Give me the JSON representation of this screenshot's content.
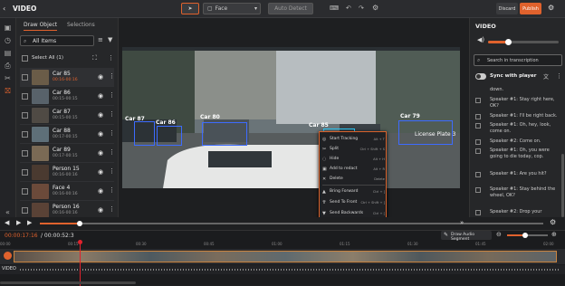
{
  "app": {
    "title": "VIDEO"
  },
  "toolbar": {
    "tool_selected": "Face",
    "auto_detect": "Auto Detect",
    "discard": "Discard",
    "publish": "Publish"
  },
  "left": {
    "tab1": "Draw Object",
    "tab2": "Selections",
    "search_placeholder": "All Items",
    "select_all": "Select All (1)",
    "objects": [
      {
        "name": "Car 85",
        "time": "00:16-00:16",
        "active": true
      },
      {
        "name": "Car 86",
        "time": "00:15-00:15",
        "active": false
      },
      {
        "name": "Car 87",
        "time": "00:15-00:15",
        "active": false
      },
      {
        "name": "Car 88",
        "time": "00:17-00:15",
        "active": false
      },
      {
        "name": "Car 89",
        "time": "00:17-00:15",
        "active": false
      },
      {
        "name": "Person 15",
        "time": "00:16-00:16",
        "active": false
      },
      {
        "name": "Face 4",
        "time": "00:16-00:16",
        "active": false
      },
      {
        "name": "Person 16",
        "time": "00:16-00:16",
        "active": false
      }
    ]
  },
  "video": {
    "labels": {
      "car87": "Car 87",
      "car86": "Car 86",
      "car80": "Car 80",
      "car85": "Car 85",
      "car79": "Car 79",
      "plate": "License Plate 3"
    }
  },
  "context_menu": {
    "items": [
      {
        "label": "Start Tracking",
        "shortcut": "Alt + T",
        "icon": "track-icon"
      },
      {
        "label": "Split",
        "shortcut": "Ctrl + Shift + S",
        "icon": "split-icon"
      },
      {
        "label": "Hide",
        "shortcut": "Alt + H",
        "icon": "hide-icon"
      },
      {
        "label": "Add to redact",
        "shortcut": "Alt + R",
        "icon": "redact-icon"
      },
      {
        "label": "Delete",
        "shortcut": "Delete",
        "icon": "delete-icon"
      },
      {
        "label": "Bring Forward",
        "shortcut": "Ctrl + ]",
        "icon": "bring-forward-icon"
      },
      {
        "label": "Send To Front",
        "shortcut": "Ctrl + Shift + ]",
        "icon": "send-front-icon"
      },
      {
        "label": "Send Backwards",
        "shortcut": "Ctrl + [",
        "icon": "send-backwards-icon"
      },
      {
        "label": "Send To Back",
        "shortcut": "Ctrl + Shift + [",
        "icon": "send-back-icon"
      }
    ]
  },
  "right": {
    "title": "VIDEO",
    "search_placeholder": "Search in transcription",
    "sync_label": "Sync with player",
    "transcript": [
      {
        "text": "down.",
        "checkbox": false
      },
      {
        "text": "Speaker #1: Stay right here, OK?",
        "checkbox": true
      },
      {
        "text": "Speaker #1: I'll be right back.",
        "checkbox": true
      },
      {
        "text": "Speaker #1: Oh, hey, look, come on.",
        "checkbox": true
      },
      {
        "text": "Speaker #2: Come on.",
        "checkbox": true
      },
      {
        "text": "Speaker #1: Oh, you were going to die today, cop.",
        "checkbox": true
      },
      {
        "text": "Speaker #1: Are you hit?",
        "checkbox": true
      },
      {
        "text": "Speaker #1: Stay behind the wheel, OK?",
        "checkbox": true
      },
      {
        "text": "Speaker #2: Drop your",
        "checkbox": true
      }
    ]
  },
  "player": {
    "current_time": "00:00:17:16",
    "total_time": "/ 00:00:52:3",
    "draw_audio": "Draw Audio Segment",
    "track_label": "VIDEO",
    "ticks": [
      "00:00",
      "00:15",
      "00:30",
      "00:45",
      "01:00",
      "01:15",
      "01:30",
      "01:45",
      "02:00"
    ]
  }
}
